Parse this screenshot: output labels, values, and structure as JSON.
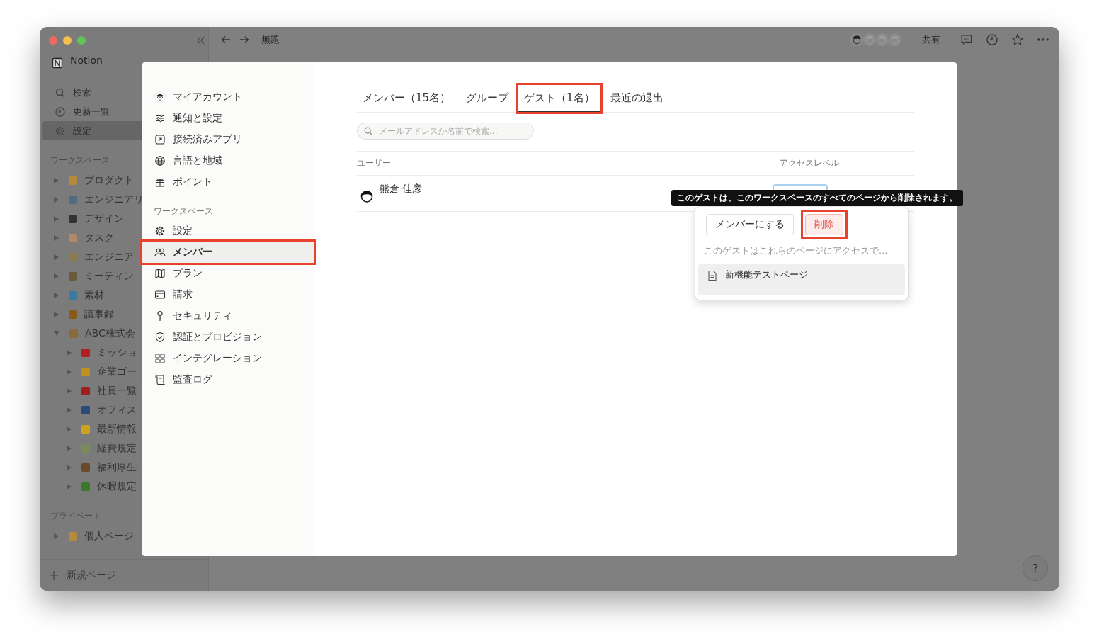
{
  "window": {
    "title": "無題",
    "actions": [
      "共有"
    ]
  },
  "sidebar": {
    "workspace_name": "Notion",
    "top_items": [
      {
        "label": "検索",
        "selected": false
      },
      {
        "label": "更新一覧",
        "selected": false
      },
      {
        "label": "設定",
        "selected": true
      }
    ],
    "sections": [
      {
        "title": "ワークスペース",
        "pages": [
          {
            "label": "プロダクト",
            "expanded": false
          },
          {
            "label": "エンジニアリ",
            "expanded": false
          },
          {
            "label": "デザイン",
            "expanded": false
          },
          {
            "label": "タスク",
            "expanded": false
          },
          {
            "label": "エンジニア",
            "expanded": false
          },
          {
            "label": "ミーティン",
            "expanded": false
          },
          {
            "label": "素材",
            "expanded": false
          },
          {
            "label": "議事録",
            "expanded": false
          },
          {
            "label": "ABC株式会",
            "expanded": true,
            "children": [
              {
                "label": "ミッショ",
                "expanded": false
              },
              {
                "label": "企業ゴー",
                "expanded": false
              },
              {
                "label": "社員一覧",
                "expanded": false
              },
              {
                "label": "オフィス",
                "expanded": false
              },
              {
                "label": "最新情報",
                "expanded": false
              },
              {
                "label": "経費規定",
                "expanded": false
              },
              {
                "label": "福利厚生",
                "expanded": false
              },
              {
                "label": "休暇規定",
                "expanded": false
              }
            ]
          }
        ]
      },
      {
        "title": "プライベート",
        "pages": [
          {
            "label": "個人ページ",
            "expanded": false
          }
        ]
      }
    ],
    "new_page": "新規ページ"
  },
  "help_button": "?",
  "settings": {
    "nav_groups": [
      {
        "items": [
          {
            "label": "マイアカウント",
            "selected": false,
            "highlighted": false
          },
          {
            "label": "通知と設定",
            "selected": false,
            "highlighted": false
          },
          {
            "label": "接続済みアプリ",
            "selected": false,
            "highlighted": false
          },
          {
            "label": "言語と地域",
            "selected": false,
            "highlighted": false
          },
          {
            "label": "ポイント",
            "selected": false,
            "highlighted": false
          }
        ]
      },
      {
        "title": "ワークスペース",
        "items": [
          {
            "label": "設定",
            "selected": false,
            "highlighted": false
          },
          {
            "label": "メンバー",
            "selected": true,
            "highlighted": true
          },
          {
            "label": "プラン",
            "selected": false,
            "highlighted": false
          },
          {
            "label": "請求",
            "selected": false,
            "highlighted": false
          },
          {
            "label": "セキュリティ",
            "selected": false,
            "highlighted": false
          },
          {
            "label": "認証とプロビジョン",
            "selected": false,
            "highlighted": false
          },
          {
            "label": "インテグレーション",
            "selected": false,
            "highlighted": false
          },
          {
            "label": "監査ログ",
            "selected": false,
            "highlighted": false
          }
        ]
      }
    ],
    "tabs": [
      {
        "label": "メンバー（15名）",
        "selected": false,
        "highlighted": false
      },
      {
        "label": "グループ",
        "selected": false,
        "highlighted": false
      },
      {
        "label": "ゲスト（1名）",
        "selected": true,
        "highlighted": true
      },
      {
        "label": "最近の退出",
        "selected": false,
        "highlighted": false
      }
    ],
    "search": {
      "placeholder": "メールアドレスか名前で検索..."
    },
    "table": {
      "columns": [
        "ユーザー",
        "アクセスレベル"
      ],
      "rows": [
        {
          "user": "熊倉 佳彦"
        }
      ]
    },
    "tooltip": "このゲストは、このワークスペースのすべてのページから削除されます。",
    "popover": {
      "buttons": [
        {
          "label": "メンバーにする",
          "kind": "normal",
          "highlighted": false
        },
        {
          "label": "削除",
          "kind": "danger",
          "highlighted": true
        }
      ],
      "note": "このゲストはこれらのページにアクセスで...",
      "pages": [
        {
          "label": "新機能テストページ"
        }
      ]
    }
  }
}
